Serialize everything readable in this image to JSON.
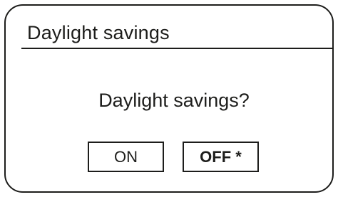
{
  "dialog": {
    "title": "Daylight savings",
    "prompt": "Daylight savings?",
    "options": [
      {
        "label": "ON",
        "selected": false
      },
      {
        "label": "OFF *",
        "selected": true
      }
    ]
  }
}
